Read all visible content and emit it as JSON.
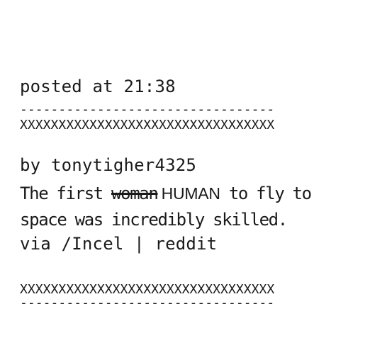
{
  "header": {
    "line1": "posted at 21:38",
    "line2": "by tonytigher4325",
    "line3": "via /Incel | reddit"
  },
  "separators": {
    "dashes": "---------------------------------",
    "x_row": "XXXXXXXXXXXXXXXXXXXXXXXXXXXXXXXXX"
  },
  "message": {
    "line1_part1": "The first ",
    "struck_word": "woman",
    "line1_part2": " HUMAN",
    "line1_part3": " to fly to",
    "line2": "space was incredibly skilled."
  }
}
